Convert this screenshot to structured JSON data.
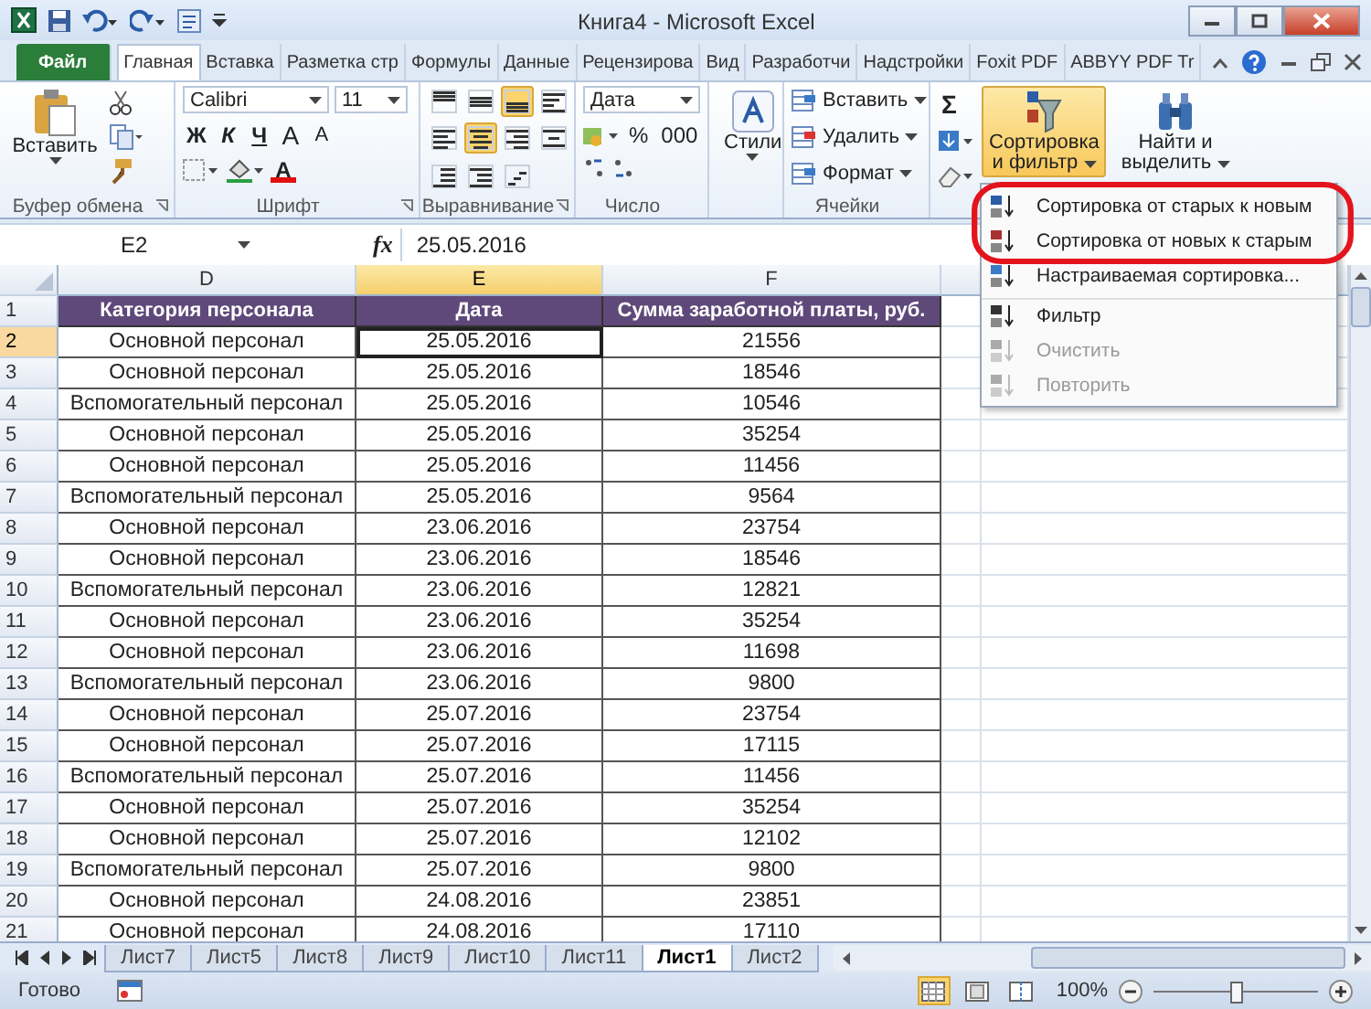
{
  "window": {
    "title": "Книга4 - Microsoft Excel"
  },
  "tabs": [
    {
      "label": "Файл",
      "kind": "file",
      "selected": false
    },
    {
      "label": "Главная",
      "kind": "tab",
      "selected": true
    },
    {
      "label": "Вставка",
      "kind": "tab",
      "selected": false
    },
    {
      "label": "Разметка стр",
      "kind": "tab",
      "selected": false
    },
    {
      "label": "Формулы",
      "kind": "tab",
      "selected": false
    },
    {
      "label": "Данные",
      "kind": "tab",
      "selected": false
    },
    {
      "label": "Рецензирова",
      "kind": "tab",
      "selected": false
    },
    {
      "label": "Вид",
      "kind": "tab",
      "selected": false
    },
    {
      "label": "Разработчи",
      "kind": "tab",
      "selected": false
    },
    {
      "label": "Надстройки",
      "kind": "tab",
      "selected": false
    },
    {
      "label": "Foxit PDF",
      "kind": "tab",
      "selected": false
    },
    {
      "label": "ABBYY PDF Tr",
      "kind": "tab",
      "selected": false
    }
  ],
  "clipboard": {
    "paste": "Вставить",
    "label": "Буфер обмена"
  },
  "font": {
    "name": "Calibri",
    "size": "11",
    "bold": "Ж",
    "italic": "К",
    "underline": "Ч",
    "grow": "A",
    "shrink": "A",
    "text_color_button": "A",
    "label": "Шрифт"
  },
  "alignment": {
    "label": "Выравнивание",
    "buttons": [
      {
        "kind": "top",
        "selected": false
      },
      {
        "kind": "middle",
        "selected": false
      },
      {
        "kind": "bottom",
        "selected": true
      },
      {
        "kind": "wrap",
        "selected": false
      },
      {
        "kind": "left",
        "selected": false
      },
      {
        "kind": "center",
        "selected": true
      },
      {
        "kind": "right",
        "selected": false
      },
      {
        "kind": "merge",
        "selected": false
      },
      {
        "kind": "outdent",
        "selected": false
      },
      {
        "kind": "indent",
        "selected": false
      },
      {
        "kind": "orientation",
        "selected": false
      }
    ]
  },
  "number": {
    "format": "Дата",
    "percent": "%",
    "thousands": "000",
    "label": "Число"
  },
  "styles": {
    "button": "Стили"
  },
  "cells": {
    "items": [
      "Вставить",
      "Удалить",
      "Формат"
    ],
    "label": "Ячейки"
  },
  "editing": {
    "sum": "Σ",
    "sort": [
      "Сортировка",
      "и фильтр"
    ],
    "sort_pressed": true,
    "find": [
      "Найти и",
      "выделить"
    ]
  },
  "formula_bar": {
    "name_box": "E2",
    "fx": "fx",
    "value": "25.05.2016"
  },
  "columns": [
    {
      "letter": "D",
      "selected": false
    },
    {
      "letter": "E",
      "selected": true
    },
    {
      "letter": "F",
      "selected": false
    }
  ],
  "header_row": {
    "number": "1",
    "cells": [
      "Категория персонала",
      "Дата",
      "Сумма заработной платы, руб."
    ]
  },
  "rows": [
    {
      "number": "2",
      "selected": true,
      "cells": [
        "Основной персонал",
        "25.05.2016",
        "21556"
      ]
    },
    {
      "number": "3",
      "selected": false,
      "cells": [
        "Основной персонал",
        "25.05.2016",
        "18546"
      ]
    },
    {
      "number": "4",
      "selected": false,
      "cells": [
        "Вспомогательный персонал",
        "25.05.2016",
        "10546"
      ]
    },
    {
      "number": "5",
      "selected": false,
      "cells": [
        "Основной персонал",
        "25.05.2016",
        "35254"
      ]
    },
    {
      "number": "6",
      "selected": false,
      "cells": [
        "Основной персонал",
        "25.05.2016",
        "11456"
      ]
    },
    {
      "number": "7",
      "selected": false,
      "cells": [
        "Вспомогательный персонал",
        "25.05.2016",
        "9564"
      ]
    },
    {
      "number": "8",
      "selected": false,
      "cells": [
        "Основной персонал",
        "23.06.2016",
        "23754"
      ]
    },
    {
      "number": "9",
      "selected": false,
      "cells": [
        "Основной персонал",
        "23.06.2016",
        "18546"
      ]
    },
    {
      "number": "10",
      "selected": false,
      "cells": [
        "Вспомогательный персонал",
        "23.06.2016",
        "12821"
      ]
    },
    {
      "number": "11",
      "selected": false,
      "cells": [
        "Основной персонал",
        "23.06.2016",
        "35254"
      ]
    },
    {
      "number": "12",
      "selected": false,
      "cells": [
        "Основной персонал",
        "23.06.2016",
        "11698"
      ]
    },
    {
      "number": "13",
      "selected": false,
      "cells": [
        "Вспомогательный персонал",
        "23.06.2016",
        "9800"
      ]
    },
    {
      "number": "14",
      "selected": false,
      "cells": [
        "Основной персонал",
        "25.07.2016",
        "23754"
      ]
    },
    {
      "number": "15",
      "selected": false,
      "cells": [
        "Основной персонал",
        "25.07.2016",
        "17115"
      ]
    },
    {
      "number": "16",
      "selected": false,
      "cells": [
        "Вспомогательный персонал",
        "25.07.2016",
        "11456"
      ]
    },
    {
      "number": "17",
      "selected": false,
      "cells": [
        "Основной персонал",
        "25.07.2016",
        "35254"
      ]
    },
    {
      "number": "18",
      "selected": false,
      "cells": [
        "Основной персонал",
        "25.07.2016",
        "12102"
      ]
    },
    {
      "number": "19",
      "selected": false,
      "cells": [
        "Вспомогательный персонал",
        "25.07.2016",
        "9800"
      ]
    },
    {
      "number": "20",
      "selected": false,
      "cells": [
        "Основной персонал",
        "24.08.2016",
        "23851"
      ]
    },
    {
      "number": "21",
      "selected": false,
      "cells": [
        "Основной персонал",
        "24.08.2016",
        "17110"
      ]
    }
  ],
  "menu": {
    "items": [
      {
        "label": "Сортировка от старых к новым",
        "kind": "sort_asc",
        "disabled": false,
        "circled": true
      },
      {
        "label": "Сортировка от новых к старым",
        "kind": "sort_desc",
        "disabled": false,
        "circled": true
      },
      {
        "label": "Настраиваемая сортировка...",
        "kind": "custom",
        "disabled": false,
        "circled": false
      },
      {
        "label": "Фильтр",
        "kind": "filter",
        "disabled": false,
        "circled": false
      },
      {
        "label": "Очистить",
        "kind": "clear",
        "disabled": true,
        "circled": false
      },
      {
        "label": "Повторить",
        "kind": "reapply",
        "disabled": true,
        "circled": false
      }
    ]
  },
  "sheets": [
    {
      "label": "Лист7",
      "selected": false
    },
    {
      "label": "Лист5",
      "selected": false
    },
    {
      "label": "Лист8",
      "selected": false
    },
    {
      "label": "Лист9",
      "selected": false
    },
    {
      "label": "Лист10",
      "selected": false
    },
    {
      "label": "Лист11",
      "selected": false
    },
    {
      "label": "Лист1",
      "selected": true
    },
    {
      "label": "Лист2",
      "selected": false
    }
  ],
  "status_bar": {
    "text": "Готово",
    "views": [
      {
        "kind": "normal",
        "selected": true
      },
      {
        "kind": "layout",
        "selected": false
      },
      {
        "kind": "pagebreak",
        "selected": false
      }
    ],
    "zoom": "100%",
    "level": 0.5
  }
}
